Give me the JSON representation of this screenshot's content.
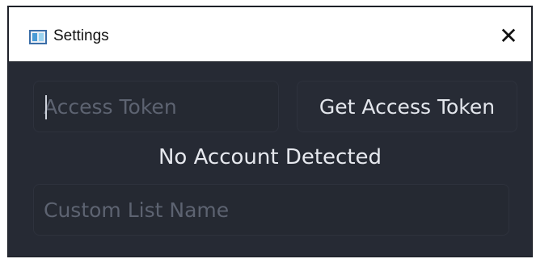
{
  "window": {
    "title": "Settings",
    "close_glyph": "✕"
  },
  "form": {
    "access_token": {
      "value": "",
      "placeholder": "Access Token"
    },
    "get_token_button": "Get Access Token",
    "status_text": "No Account Detected",
    "custom_list": {
      "value": "",
      "placeholder": "Custom List Name"
    }
  },
  "icons": {
    "app": "window-app-icon",
    "close": "close-icon"
  },
  "colors": {
    "background": "#262a34",
    "titlebar": "#ffffff",
    "field_border": "#2e323d",
    "placeholder": "#5d6371",
    "text": "#e6e8ee"
  }
}
